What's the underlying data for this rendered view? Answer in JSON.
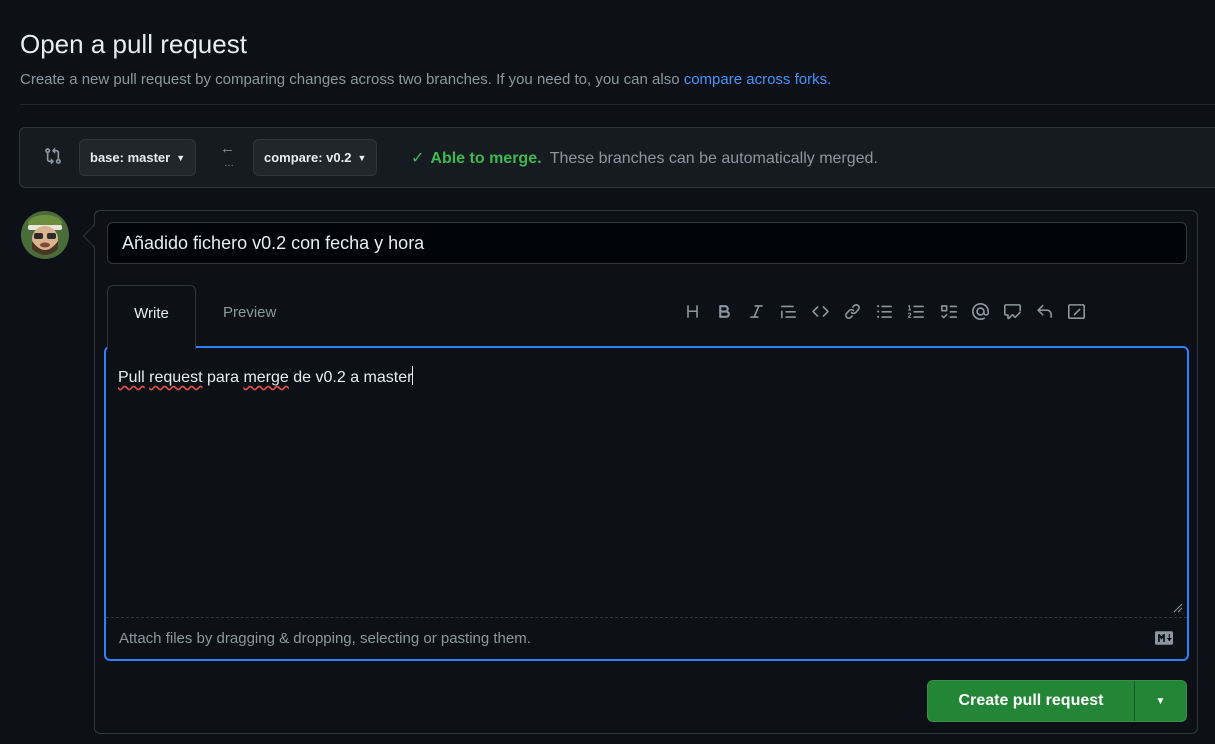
{
  "header": {
    "title": "Open a pull request",
    "subtitle": "Create a new pull request by comparing changes across two branches. If you need to, you can also ",
    "compare_forks_link": "compare across forks."
  },
  "range": {
    "base_label": "base: master",
    "compare_label": "compare: v0.2",
    "merge_status_strong": "Able to merge.",
    "merge_status_text": "These branches can be automatically merged."
  },
  "form": {
    "title_value": "Añadido fichero v0.2 con fecha y hora",
    "tabs": {
      "write": "Write",
      "preview": "Preview"
    },
    "body_words": [
      "Pull",
      "request",
      "para",
      "merge",
      "de v0.2 a master"
    ],
    "attach_hint": "Attach files by dragging & dropping, selecting or pasting them.",
    "toolbar": [
      "heading-icon",
      "bold-icon",
      "italic-icon",
      "quote-icon",
      "code-icon",
      "link-icon",
      "unordered-list-icon",
      "ordered-list-icon",
      "task-list-icon",
      "mention-icon",
      "reference-icon",
      "reply-icon",
      "fullscreen-icon"
    ]
  },
  "actions": {
    "create_label": "Create pull request"
  },
  "colors": {
    "accent_blue": "#2f81f7",
    "success_green": "#3fb950",
    "button_green": "#238636"
  }
}
